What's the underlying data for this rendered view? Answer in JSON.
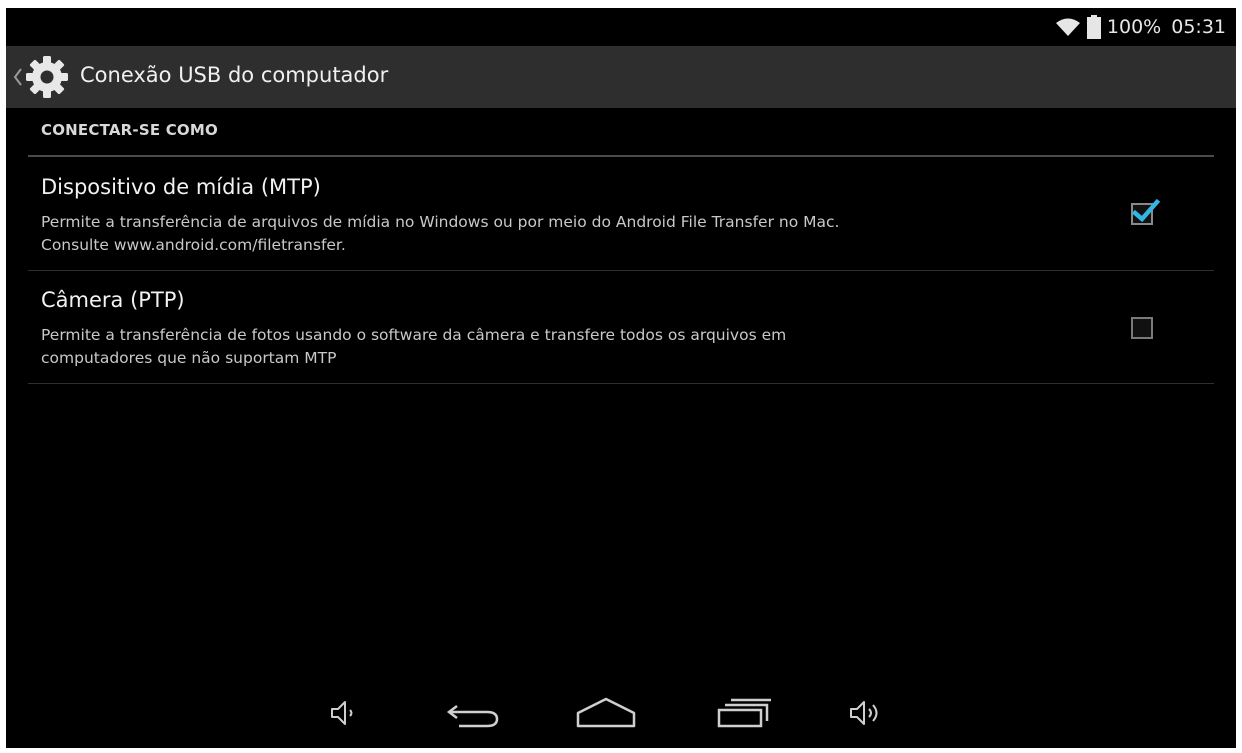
{
  "status_bar": {
    "battery_text": "100%",
    "time": "05:31",
    "icons": [
      "wifi-icon",
      "battery-icon"
    ]
  },
  "action_bar": {
    "title": "Conexão USB do computador",
    "icon": "settings-gear-icon"
  },
  "section": {
    "header": "CONECTAR-SE COMO"
  },
  "options": [
    {
      "title": "Dispositivo de mídia (MTP)",
      "summary_line1": "Permite a transferência de arquivos de mídia no Windows ou por meio do Android File Transfer no Mac.",
      "summary_line2": "Consulte www.android.com/filetransfer.",
      "checked": true
    },
    {
      "title": "Câmera (PTP)",
      "summary_line1": "Permite a transferência de fotos usando o software da câmera e transfere todos os arquivos em",
      "summary_line2": "computadores que não suportam MTP",
      "checked": false
    }
  ],
  "nav_bar": {
    "buttons": [
      "volume-down-icon",
      "back-icon",
      "home-icon",
      "recent-apps-icon",
      "volume-up-icon"
    ]
  },
  "colors": {
    "accent": "#33b5e5",
    "background": "#000000",
    "action_bar": "#2e2e2e"
  }
}
